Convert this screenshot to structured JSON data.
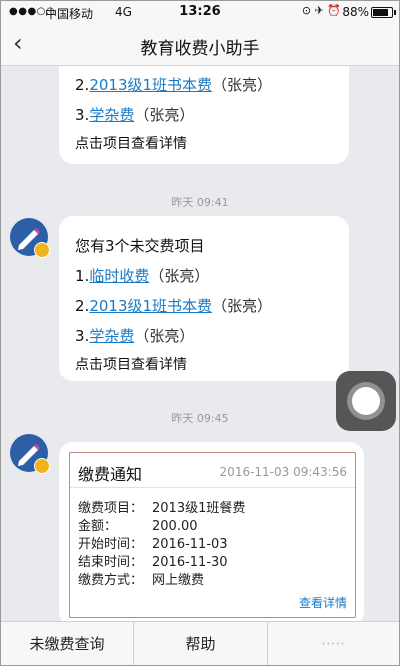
{
  "status_bar": {
    "signal": "●●●○○",
    "carrier": "中国移动",
    "network": "4G",
    "time": "13:26",
    "icons": "⊙ ✈ ⏰",
    "battery_text": "88%",
    "battery_level": 0.88
  },
  "nav": {
    "back": "‹",
    "title": "教育收费小助手"
  },
  "messages": {
    "m1": {
      "line2_prefix": "2.",
      "line2_link": "2013级1班书本费",
      "line2_name": "（张亮）",
      "line3_prefix": "3.",
      "line3_link": "学杂费",
      "line3_name": "（张亮）",
      "hint": "点击项目查看详情"
    },
    "ts1": "昨天 09:41",
    "m2": {
      "intro": "您有3个未交费项目",
      "line1_prefix": "1.",
      "line1_link": "临时收费",
      "line1_name": "（张亮）",
      "line2_prefix": "2.",
      "line2_link": "2013级1班书本费",
      "line2_name": "（张亮）",
      "line3_prefix": "3.",
      "line3_link": "学杂费",
      "line3_name": "（张亮）",
      "hint": "点击项目查看详情"
    },
    "ts2": "昨天 09:45",
    "notice": {
      "title": "缴费通知",
      "datetime": "2016-11-03 09:43:56",
      "rows": [
        {
          "label": "缴费项目：",
          "value": "2013级1班餐费"
        },
        {
          "label": "金额：",
          "value": "200.00"
        },
        {
          "label": "开始时间：",
          "value": "2016-11-03"
        },
        {
          "label": "结束时间：",
          "value": "2016-11-30"
        },
        {
          "label": "缴费方式：",
          "value": "网上缴费"
        }
      ],
      "link": "查看详情"
    }
  },
  "tabs": {
    "t1": "未缴费查询",
    "t2": "帮助",
    "t3": "·····"
  },
  "colors": {
    "link": "#1a7ac4",
    "avatar": "#2c5fa8",
    "badge": "#f2b21b"
  }
}
